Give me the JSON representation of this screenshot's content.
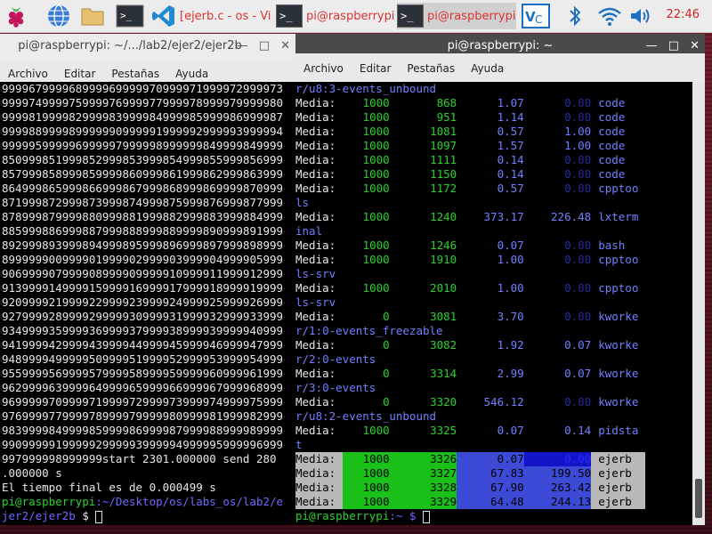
{
  "taskbar": {
    "task1": "[ejerb.c - os - Vi...",
    "task2": "pi@raspberrypi: ...",
    "task3": "pi@raspberrypi: ...",
    "clock": "22:46"
  },
  "left": {
    "title": "pi@raspberrypi: ~/.../lab2/ejer2/ejer2b",
    "menu": [
      "Archivo",
      "Editar",
      "Pestañas",
      "Ayuda"
    ],
    "lines": [
      "999967999968999969999970999971999972999973",
      "999974999975999976999977999978999979999980",
      "999981999982999983999984999985999986999987",
      "999988999989999990999991999992999993999994",
      "999995999996999997999998999999849999849999",
      "850999851999852999853999854999855999856999",
      "857999858999859999860999861999862999863999",
      "864999865999866999867999868999869999870999",
      "871999872999873999874999875999876999877999",
      "878999879999880999881999882999883999884999",
      "885999886999887999888999889999890999891999",
      "892999893999894999895999896999897999898999",
      "899999900999901999902999903999904999905999",
      "906999907999908999909999910999911999912999",
      "913999914999915999916999917999918999919999",
      "920999921999922999923999924999925999926999",
      "927999928999929999930999931999932999933999",
      "934999935999936999937999938999939999940999",
      "941999942999943999944999945999946999947999",
      "948999949999950999951999952999953999954999",
      "955999956999957999958999959999960999961999",
      "962999963999964999965999966999967999968999",
      "969999970999971999972999973999974999975999",
      "976999977999978999979999980999981999982999",
      "983999984999985999986999987999988999989999",
      "990999991999992999993999994999995999996999",
      "997999998999999start 2301.000000 send 280",
      ".000000 s",
      "El tiempo final es de 0.000499 s"
    ],
    "prompt_user": "pi@raspberrypi",
    "prompt_path": ":~/Desktop/os/labs_os/lab2/e",
    "prompt_path2": "jer2/ejer2b",
    "prompt_sign": " $ "
  },
  "right": {
    "title": "pi@raspberrypi: ~",
    "menu": [
      "Archivo",
      "Editar",
      "Pestañas",
      "Ayuda"
    ],
    "rows": [
      {
        "wrap": "r/u8:3-events_unbound"
      },
      {
        "label": "Media:",
        "n": "1000",
        "pid": "868",
        "a": "1.07",
        "b": "0.00",
        "name": "code"
      },
      {
        "label": "Media:",
        "n": "1000",
        "pid": "951",
        "a": "1.14",
        "b": "0.00",
        "name": "code"
      },
      {
        "label": "Media:",
        "n": "1000",
        "pid": "1081",
        "a": "0.57",
        "b": "1.00",
        "name": "code"
      },
      {
        "label": "Media:",
        "n": "1000",
        "pid": "1097",
        "a": "1.57",
        "b": "1.00",
        "name": "code"
      },
      {
        "label": "Media:",
        "n": "1000",
        "pid": "1111",
        "a": "0.14",
        "b": "0.00",
        "name": "code"
      },
      {
        "label": "Media:",
        "n": "1000",
        "pid": "1150",
        "a": "0.14",
        "b": "0.00",
        "name": "code"
      },
      {
        "label": "Media:",
        "n": "1000",
        "pid": "1172",
        "a": "0.57",
        "b": "0.00",
        "name": "cpptoo"
      },
      {
        "wrap": "ls"
      },
      {
        "label": "Media:",
        "n": "1000",
        "pid": "1240",
        "a": "373.17",
        "b": "226.48",
        "name": "lxterm"
      },
      {
        "wrap": "inal"
      },
      {
        "label": "Media:",
        "n": "1000",
        "pid": "1246",
        "a": "0.07",
        "b": "0.00",
        "name": "bash"
      },
      {
        "label": "Media:",
        "n": "1000",
        "pid": "1910",
        "a": "1.00",
        "b": "0.00",
        "name": "cpptoo"
      },
      {
        "wrap": "ls-srv"
      },
      {
        "label": "Media:",
        "n": "1000",
        "pid": "2010",
        "a": "1.00",
        "b": "0.00",
        "name": "cpptoo"
      },
      {
        "wrap": "ls-srv"
      },
      {
        "label": "Media:",
        "n": "0",
        "pid": "3081",
        "a": "3.70",
        "b": "0.00",
        "name": "kworke"
      },
      {
        "wrap": "r/1:0-events_freezable"
      },
      {
        "label": "Media:",
        "n": "0",
        "pid": "3082",
        "a": "1.92",
        "b": "0.07",
        "name": "kworke"
      },
      {
        "wrap": "r/2:0-events"
      },
      {
        "label": "Media:",
        "n": "0",
        "pid": "3314",
        "a": "2.99",
        "b": "0.07",
        "name": "kworke"
      },
      {
        "wrap": "r/3:0-events"
      },
      {
        "label": "Media:",
        "n": "0",
        "pid": "3320",
        "a": "546.12",
        "b": "0.00",
        "name": "kworke"
      },
      {
        "wrap": "r/u8:2-events_unbound"
      },
      {
        "label": "Media:",
        "n": "1000",
        "pid": "3325",
        "a": "0.07",
        "b": "0.14",
        "name": "pidsta"
      },
      {
        "wrap": "t"
      },
      {
        "label": "Media:",
        "n": "1000",
        "pid": "3326",
        "a": "0.07",
        "b": "0.00",
        "name": "ejerb",
        "hl": true,
        "dark": true
      },
      {
        "label": "Media:",
        "n": "1000",
        "pid": "3327",
        "a": "67.83",
        "b": "199.50",
        "name": "ejerb",
        "hl": true
      },
      {
        "label": "Media:",
        "n": "1000",
        "pid": "3328",
        "a": "67.90",
        "b": "263.42",
        "name": "ejerb",
        "hl": true
      },
      {
        "label": "Media:",
        "n": "1000",
        "pid": "3329",
        "a": "64.48",
        "b": "244.13",
        "name": "ejerb",
        "hl": true
      }
    ],
    "prompt_user": "pi@raspberrypi",
    "prompt_path": ":~ $ "
  }
}
